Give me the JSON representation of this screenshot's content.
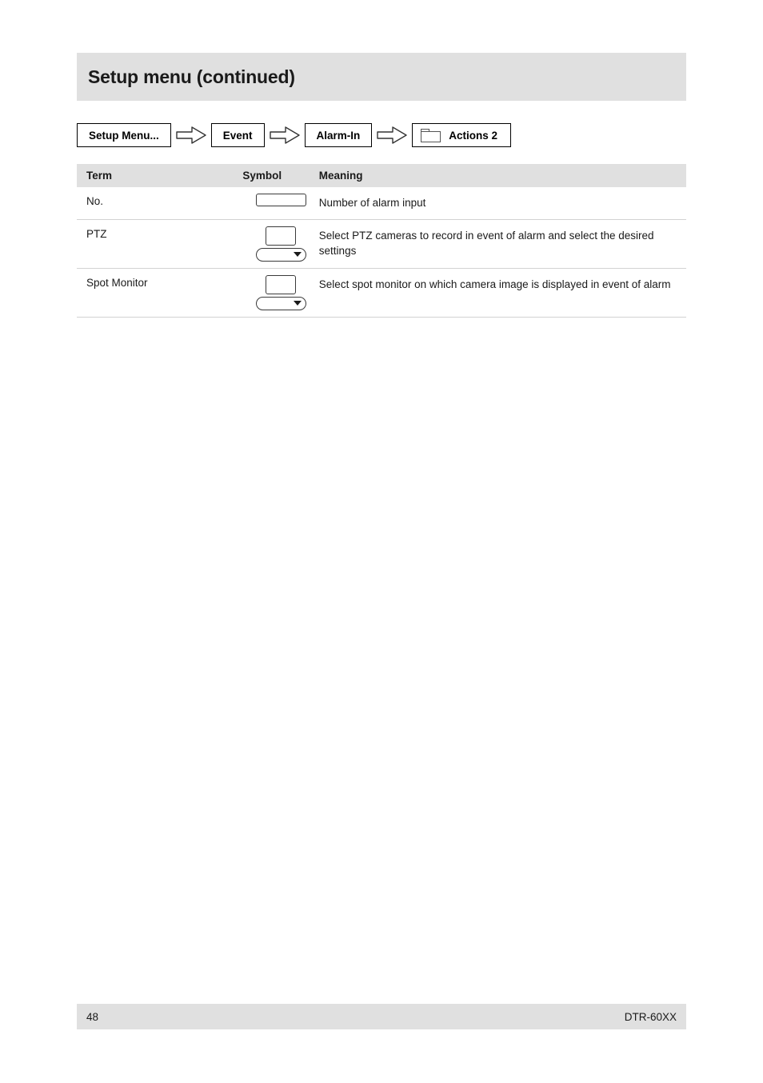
{
  "header": {
    "title": "Setup menu (continued)"
  },
  "breadcrumb": {
    "items": [
      {
        "label": "Setup Menu...",
        "icon": null
      },
      {
        "label": "Event",
        "icon": null
      },
      {
        "label": "Alarm-In",
        "icon": null
      },
      {
        "label": "Actions 2",
        "icon": "folder-icon"
      }
    ],
    "separator_icon": "right-arrow-icon"
  },
  "table": {
    "columns": [
      "Term",
      "Symbol",
      "Meaning"
    ],
    "rows": [
      {
        "term": "No.",
        "symbol": "text-field",
        "meaning": "Number of alarm input"
      },
      {
        "term": "PTZ",
        "symbol": "field-with-dropdown",
        "meaning": "Select PTZ cameras to record in event of alarm and select the desired settings"
      },
      {
        "term": "Spot Monitor",
        "symbol": "field-with-dropdown",
        "meaning": "Select spot monitor on which camera image is displayed in event of alarm"
      }
    ]
  },
  "footer": {
    "page_number": "48",
    "model": "DTR-60XX"
  }
}
